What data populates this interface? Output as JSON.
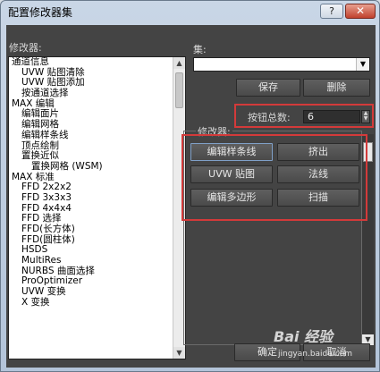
{
  "window": {
    "title": "配置修改器集",
    "help_label": "?",
    "close_label": "✕"
  },
  "left": {
    "label": "修改器:",
    "items": [
      "通道信息",
      "UVW 贴图清除",
      "UVW 贴图添加",
      "按通道选择",
      "MAX 编辑",
      "编辑面片",
      "编辑网格",
      "编辑样条线",
      "顶点绘制",
      "置换近似",
      "置换网格 (WSM)",
      "MAX 标准",
      "FFD 2x2x2",
      "FFD 3x3x3",
      "FFD 4x4x4",
      "FFD 选择",
      "FFD(长方体)",
      "FFD(圆柱体)",
      "HSDS",
      "MultiRes",
      "NURBS 曲面选择",
      "ProOptimizer",
      "UVW 变换",
      "X 变换"
    ],
    "indent_levels": [
      0,
      1,
      1,
      1,
      0,
      1,
      1,
      1,
      1,
      1,
      2,
      0,
      1,
      1,
      1,
      1,
      1,
      1,
      1,
      1,
      1,
      1,
      1,
      1
    ]
  },
  "set": {
    "label": "集:",
    "value": "",
    "save_label": "保存",
    "delete_label": "删除"
  },
  "count": {
    "label": "按钮总数:",
    "value": "6"
  },
  "modifiers": {
    "label": "修改器:",
    "buttons": [
      "编辑样条线",
      "挤出",
      "UVW 贴图",
      "法线",
      "编辑多边形",
      "扫描"
    ]
  },
  "footer": {
    "ok_label": "确定",
    "cancel_label": "取消"
  },
  "watermark": {
    "brand": "Bai 经验",
    "url": "jingyan.baidu.com"
  },
  "colors": {
    "panel": "#444444",
    "highlight": "#d33a3a",
    "title_bar": "#c9d6e6"
  }
}
